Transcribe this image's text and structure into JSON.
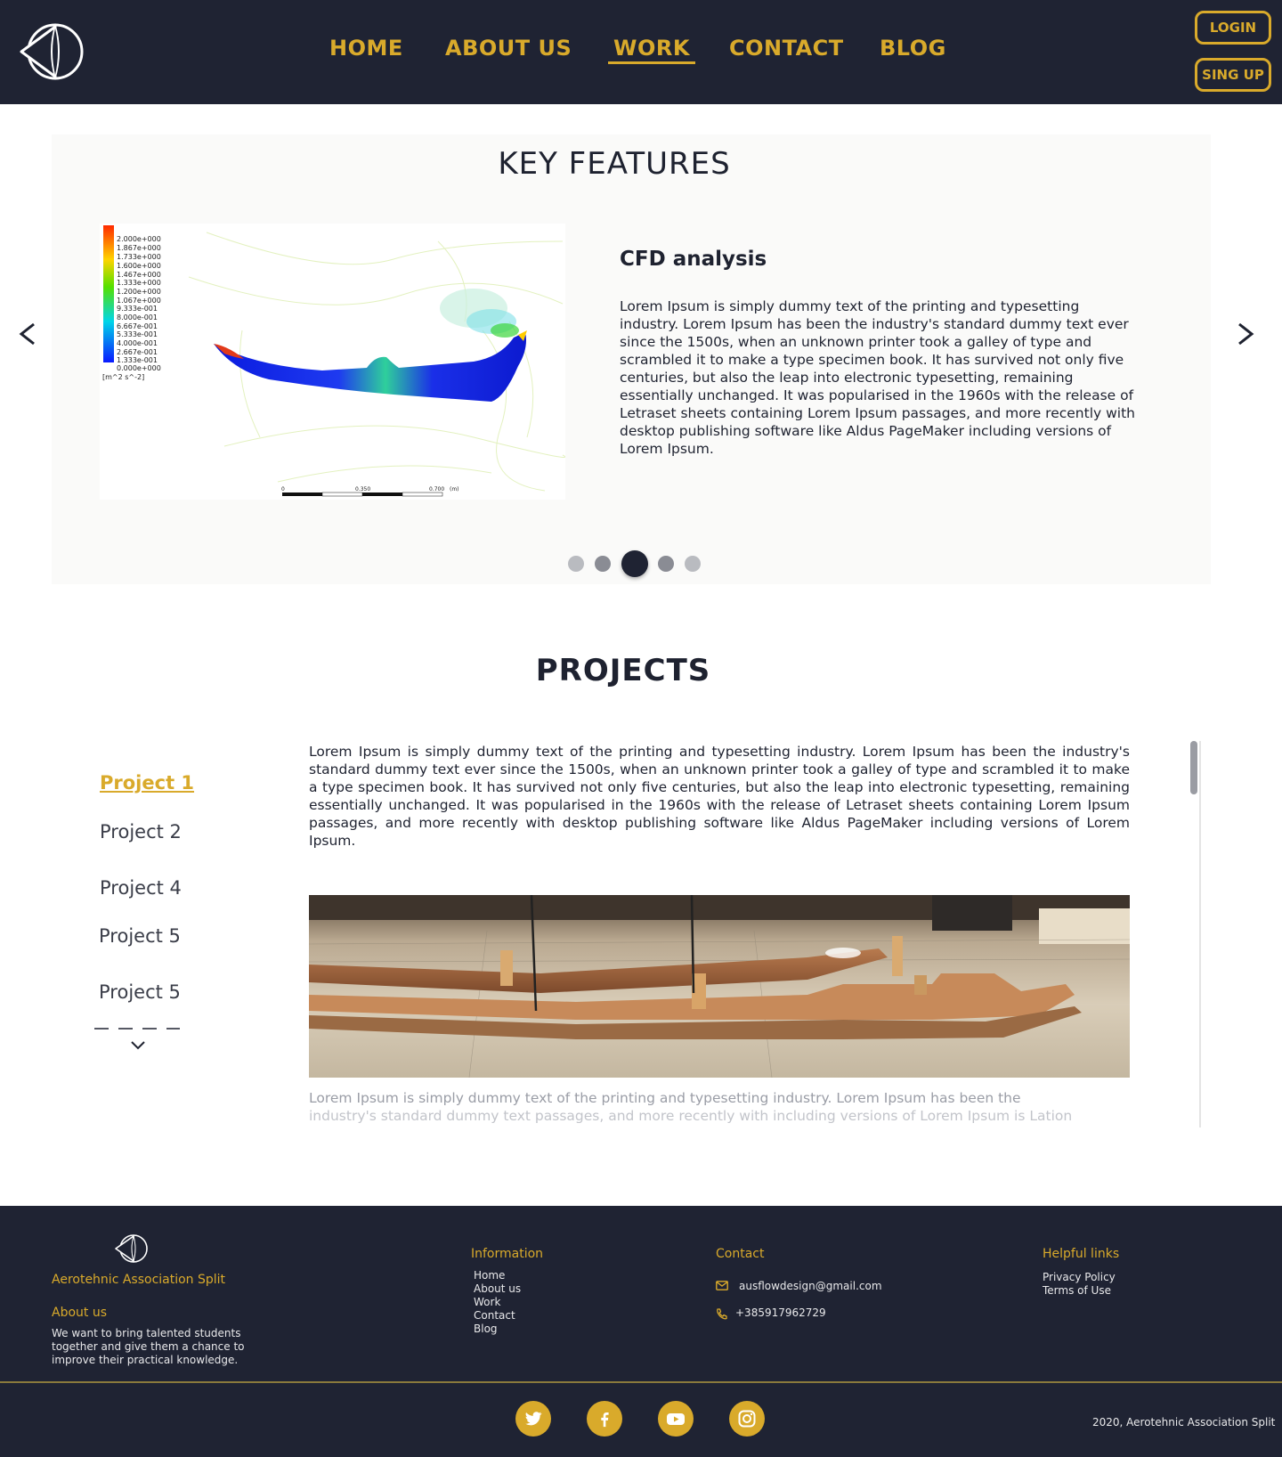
{
  "nav": {
    "items": [
      {
        "label": "HOME"
      },
      {
        "label": "ABOUT US"
      },
      {
        "label": "WORK"
      },
      {
        "label": "CONTACT"
      },
      {
        "label": "BLOG"
      }
    ],
    "active": "WORK",
    "login_label": "LOGIN",
    "signup_label": "SING UP"
  },
  "key_features": {
    "title": "KEY FEATURES",
    "slide_heading": "CFD analysis",
    "slide_text": "Lorem Ipsum is simply dummy text of the printing and typesetting industry. Lorem Ipsum has been the industry's standard dummy text ever since the 1500s, when an unknown printer took a galley of type and scrambled it to make a type specimen book. It has survived not only five centuries, but also the leap into electronic typesetting, remaining essentially unchanged. It was popularised in the 1960s with the release of Letraset sheets containing Lorem Ipsum passages, and more recently with desktop publishing software like Aldus PageMaker including versions of Lorem Ipsum.",
    "slide_count": 5,
    "active_slide": 3,
    "legend": {
      "values": [
        "2.000e+000",
        "1.867e+000",
        "1.733e+000",
        "1.600e+000",
        "1.467e+000",
        "1.333e+000",
        "1.200e+000",
        "1.067e+000",
        "9.333e-001",
        "8.000e-001",
        "6.667e-001",
        "5.333e-001",
        "4.000e-001",
        "2.667e-001",
        "1.333e-001",
        "0.000e+000"
      ],
      "unit": "[m^2 s^-2]",
      "scale_labels": [
        "0",
        "0.350",
        "0.700",
        "(m)"
      ]
    }
  },
  "projects": {
    "title": "PROJECTS",
    "items": [
      {
        "label": "Project 1"
      },
      {
        "label": "Project 2"
      },
      {
        "label": "Project 4"
      },
      {
        "label": "Project 5"
      },
      {
        "label": "Project 5"
      }
    ],
    "active": "Project 1",
    "text": "Lorem Ipsum is simply dummy text of the printing and typesetting industry. Lorem Ipsum has been the industry's standard dummy text ever since the 1500s, when an unknown printer took a galley of type and scrambled it to make a type specimen book. It has survived not only five centuries, but also the leap into electronic typesetting, remaining essentially unchanged. It was popularised in the 1960s with the release of Letraset sheets containing Lorem Ipsum passages, and more recently with desktop publishing software like Aldus PageMaker including versions of Lorem Ipsum.",
    "fade_line1": "Lorem Ipsum is simply dummy text of the printing and typesetting industry. Lorem Ipsum has been the",
    "fade_line2": "industry's standard dummy text  passages, and more recently with  including versions of Lorem  Ipsum is  Lation"
  },
  "footer": {
    "org_name": "Aerotehnic Association Split",
    "about_heading": "About us",
    "about_text_lines": [
      "We want to bring talented students",
      "together and give them a chance to",
      "improve their practical knowledge."
    ],
    "info_heading": "Information",
    "info_links": [
      {
        "label": "Home"
      },
      {
        "label": "About us"
      },
      {
        "label": "Work"
      },
      {
        "label": "Contact"
      },
      {
        "label": "Blog"
      }
    ],
    "contact_heading": "Contact",
    "email": "ausflowdesign@gmail.com",
    "phone": "+385917962729",
    "helpful_heading": "Helpful links",
    "helpful_links": [
      {
        "label": "Privacy Policy"
      },
      {
        "label": "Terms of Use"
      }
    ],
    "copyright": "2020, Aerotehnic Association Split",
    "social": [
      "twitter-icon",
      "facebook-icon",
      "youtube-icon",
      "instagram-icon"
    ]
  },
  "colors": {
    "navy": "#1f2333",
    "gold": "#d9aa2b",
    "panel": "#fafaf9"
  }
}
